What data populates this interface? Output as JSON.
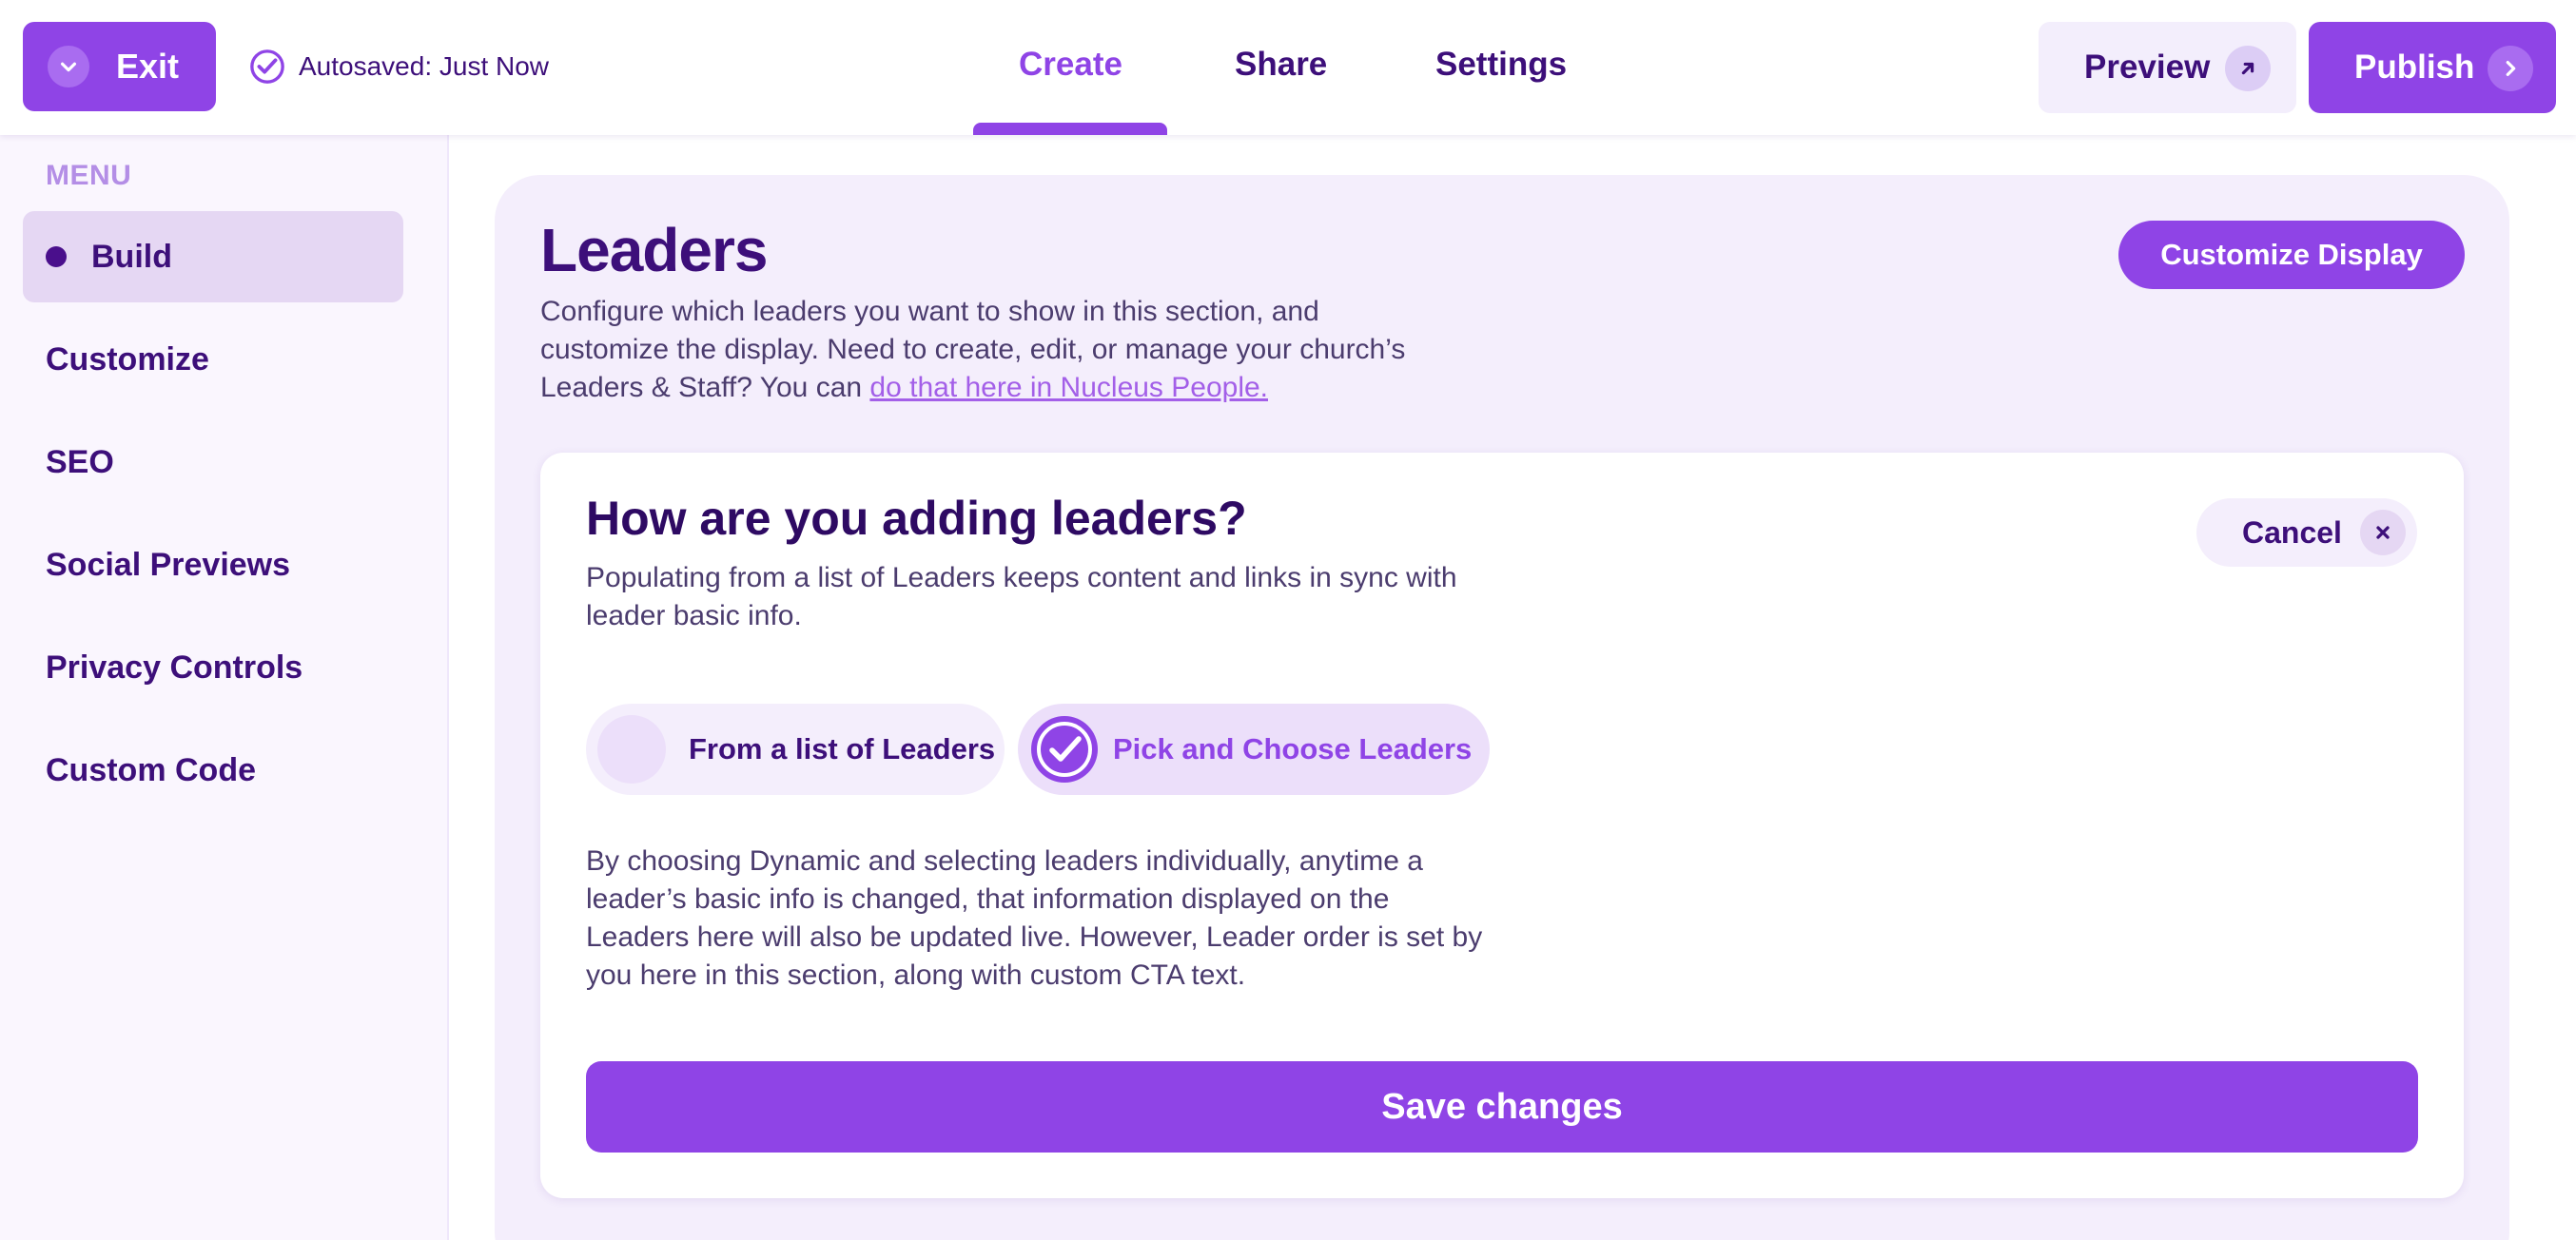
{
  "topbar": {
    "exit_label": "Exit",
    "autosave_text": "Autosaved: Just Now",
    "tabs": [
      {
        "label": "Create",
        "active": true
      },
      {
        "label": "Share",
        "active": false
      },
      {
        "label": "Settings",
        "active": false
      }
    ],
    "preview_label": "Preview",
    "publish_label": "Publish"
  },
  "sidebar": {
    "menu_label": "MENU",
    "items": [
      {
        "label": "Build",
        "active": true
      },
      {
        "label": "Customize",
        "active": false
      },
      {
        "label": "SEO",
        "active": false
      },
      {
        "label": "Social Previews",
        "active": false
      },
      {
        "label": "Privacy Controls",
        "active": false
      },
      {
        "label": "Custom Code",
        "active": false
      }
    ]
  },
  "panel": {
    "title": "Leaders",
    "description": "Configure which leaders you want to show in this section, and customize the display. Need to create, edit, or manage your church’s Leaders & Staff? You can ",
    "link_text": "do that here in Nucleus People.",
    "customize_label": "Customize Display"
  },
  "card": {
    "title": "How are you adding leaders?",
    "description": "Populating from a list of Leaders keeps content and links in sync with leader basic info.",
    "cancel_label": "Cancel",
    "options": [
      {
        "label": "From a list of Leaders",
        "selected": false
      },
      {
        "label": "Pick and Choose Leaders",
        "selected": true
      }
    ],
    "note": "By choosing Dynamic and selecting leaders individually, anytime a leader’s basic info is changed, that information displayed on the Leaders here will also be updated live. However, Leader order is set by you here in this section, along with custom CTA text.",
    "save_label": "Save changes"
  },
  "colors": {
    "accent": "#8f44e6",
    "dark_text": "#3d0f7a",
    "panel_bg": "#f4eefc",
    "link": "#a35fe8"
  },
  "icons": [
    "chevron-down-icon",
    "check-circle-icon",
    "arrow-up-right-icon",
    "chevron-right-icon",
    "close-icon",
    "check-circle-selected-icon"
  ]
}
